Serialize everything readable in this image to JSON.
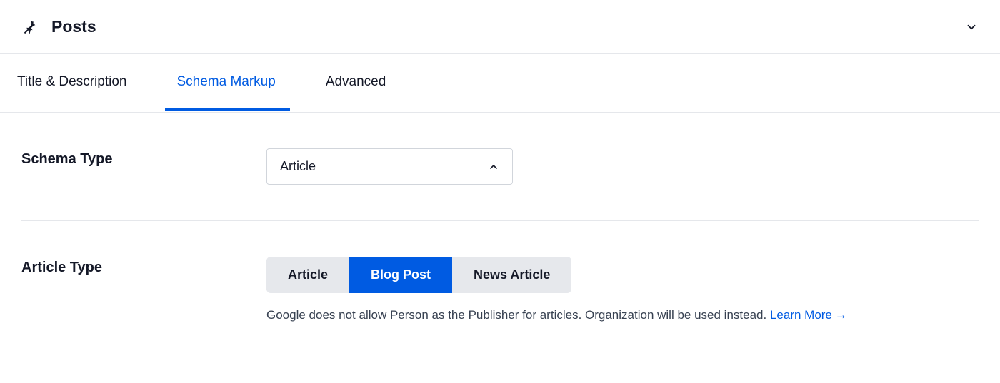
{
  "header": {
    "title": "Posts"
  },
  "tabs": {
    "items": [
      {
        "label": "Title & Description"
      },
      {
        "label": "Schema Markup"
      },
      {
        "label": "Advanced"
      }
    ],
    "active_index": 1
  },
  "schema_type": {
    "label": "Schema Type",
    "selected": "Article"
  },
  "article_type": {
    "label": "Article Type",
    "options": [
      {
        "label": "Article"
      },
      {
        "label": "Blog Post"
      },
      {
        "label": "News Article"
      }
    ],
    "active_index": 1,
    "helper_text": "Google does not allow Person as the Publisher for articles. Organization will be used instead. ",
    "learn_more": "Learn More"
  }
}
